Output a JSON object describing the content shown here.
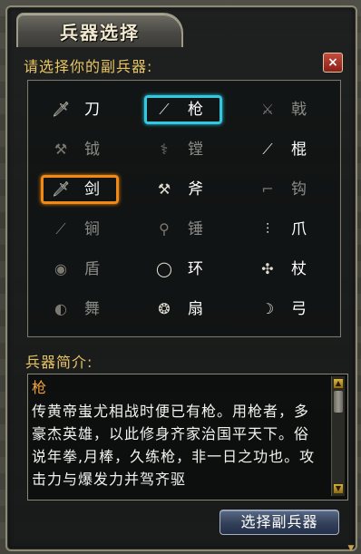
{
  "window": {
    "title": "兵器选择"
  },
  "prompt_label": "请选择你的副兵器:",
  "close_label": "×",
  "weapons": [
    {
      "label": "刀",
      "icon": "blade-icon",
      "glyph": "🗡",
      "enabled": true
    },
    {
      "label": "枪",
      "icon": "spear-icon",
      "glyph": "⟋",
      "enabled": true,
      "selected": "cyan"
    },
    {
      "label": "戟",
      "icon": "halberd-icon",
      "glyph": "⚔",
      "enabled": false
    },
    {
      "label": "钺",
      "icon": "battle-axe-icon",
      "glyph": "⚒",
      "enabled": false
    },
    {
      "label": "镗",
      "icon": "trident-icon",
      "glyph": "⚕",
      "enabled": false
    },
    {
      "label": "棍",
      "icon": "staff-icon",
      "glyph": "⟋",
      "enabled": true
    },
    {
      "label": "剑",
      "icon": "sword-icon",
      "glyph": "🗡",
      "enabled": true,
      "selected": "orange"
    },
    {
      "label": "斧",
      "icon": "axe-icon",
      "glyph": "⚒",
      "enabled": true
    },
    {
      "label": "钩",
      "icon": "hook-icon",
      "glyph": "⌐",
      "enabled": false
    },
    {
      "label": "锏",
      "icon": "mace-icon",
      "glyph": "⟋",
      "enabled": false
    },
    {
      "label": "锤",
      "icon": "hammer-icon",
      "glyph": "⚲",
      "enabled": false
    },
    {
      "label": "爪",
      "icon": "claw-icon",
      "glyph": "⫶",
      "enabled": true
    },
    {
      "label": "盾",
      "icon": "shield-icon",
      "glyph": "◉",
      "enabled": false
    },
    {
      "label": "环",
      "icon": "ring-icon",
      "glyph": "◯",
      "enabled": true
    },
    {
      "label": "杖",
      "icon": "scepter-icon",
      "glyph": "✣",
      "enabled": true
    },
    {
      "label": "舞",
      "icon": "fan-dance-icon",
      "glyph": "◐",
      "enabled": false
    },
    {
      "label": "扇",
      "icon": "fan-icon",
      "glyph": "❂",
      "enabled": true
    },
    {
      "label": "弓",
      "icon": "bow-icon",
      "glyph": "☽",
      "enabled": true
    }
  ],
  "intro_label": "兵器简介:",
  "description": {
    "title": "枪",
    "text": "传黄帝蚩尤相战时便已有枪。用枪者，多豪杰英雄，以此修身齐家治国平天下。俗说年拳,月棒，久练枪，非一日之功也。攻击力与爆发力并驾齐驱"
  },
  "scroll_up": "▲",
  "scroll_down": "▼",
  "confirm_label": "选择副兵器",
  "corner_icon": "▼",
  "colors": {
    "accent_gold": "#e8c463",
    "select_cyan": "#33c8e0",
    "select_orange": "#f08a14",
    "desc_title": "#f0a23a"
  }
}
